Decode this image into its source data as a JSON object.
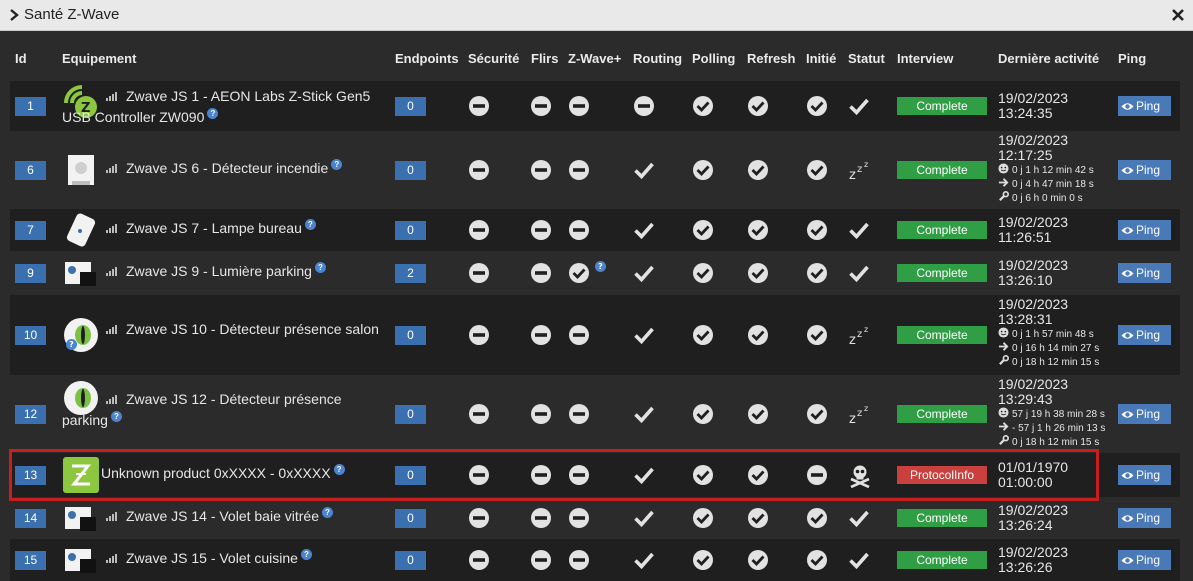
{
  "window": {
    "title": "Santé Z-Wave"
  },
  "columns": [
    "Id",
    "Equipement",
    "Endpoints",
    "Sécurité",
    "Flirs",
    "Z-Wave+",
    "Routing",
    "Polling",
    "Refresh",
    "Initié",
    "Statut",
    "Interview",
    "Dernière activité",
    "Ping"
  ],
  "ping_label": "Ping",
  "rows": [
    {
      "id": "1",
      "name_line1": "Zwave JS 1 - AEON Labs Z-Stick Gen5",
      "name_line2": "USB Controller ZW090",
      "endpoints": "0",
      "icons": [
        "dash",
        "dash",
        "dash",
        "dash",
        "check-circle",
        "check-circle",
        "check-circle",
        "check"
      ],
      "status": "Complete",
      "status_color": "#2f9e44",
      "activity": [
        "19/02/2023",
        "13:24:35"
      ],
      "details": []
    },
    {
      "id": "6",
      "name_line1": "Zwave JS 6 - Détecteur incendie",
      "name_line2": "",
      "endpoints": "0",
      "icons": [
        "dash",
        "dash",
        "dash",
        "check",
        "check-circle",
        "check-circle",
        "check-circle",
        "sleep"
      ],
      "status": "Complete",
      "status_color": "#2f9e44",
      "activity": [
        "19/02/2023",
        "12:17:25"
      ],
      "details": [
        "0 j 1 h 12 min 42 s",
        "0 j 4 h 47 min 18 s",
        "0 j 6 h 0 min 0 s"
      ]
    },
    {
      "id": "7",
      "name_line1": "Zwave JS 7 - Lampe bureau",
      "name_line2": "",
      "endpoints": "0",
      "icons": [
        "dash",
        "dash",
        "dash",
        "check",
        "check-circle",
        "check-circle",
        "check-circle",
        "check"
      ],
      "status": "Complete",
      "status_color": "#2f9e44",
      "activity": [
        "19/02/2023",
        "11:26:51"
      ],
      "details": []
    },
    {
      "id": "9",
      "name_line1": "Zwave JS 9 - Lumière parking",
      "name_line2": "",
      "endpoints": "2",
      "icons": [
        "dash",
        "dash",
        "check-circle-q",
        "check",
        "check-circle",
        "check-circle",
        "check-circle",
        "check"
      ],
      "status": "Complete",
      "status_color": "#2f9e44",
      "activity": [
        "19/02/2023",
        "13:26:10"
      ],
      "details": []
    },
    {
      "id": "10",
      "name_line1": "Zwave JS 10 - Détecteur présence salon",
      "name_line2": "",
      "endpoints": "0",
      "icons": [
        "dash",
        "dash",
        "dash",
        "check",
        "check-circle",
        "check-circle",
        "check-circle",
        "sleep"
      ],
      "status": "Complete",
      "status_color": "#2f9e44",
      "activity": [
        "19/02/2023",
        "13:28:31"
      ],
      "details": [
        "0 j 1 h 57 min 48 s",
        "0 j 16 h 14 min 27 s",
        "0 j 18 h 12 min 15 s"
      ]
    },
    {
      "id": "12",
      "name_line1": "Zwave JS 12 - Détecteur présence",
      "name_line2": "parking",
      "endpoints": "0",
      "icons": [
        "dash",
        "dash",
        "dash",
        "check",
        "check-circle",
        "check-circle",
        "check-circle",
        "sleep"
      ],
      "status": "Complete",
      "status_color": "#2f9e44",
      "activity": [
        "19/02/2023",
        "13:29:43"
      ],
      "details": [
        "57 j 19 h 38 min 28 s",
        "- 57 j 1 h 26 min 13 s",
        "0 j 18 h 12 min 15 s"
      ]
    },
    {
      "id": "13",
      "name_line1": "Unknown product 0xXXXX - 0xXXXX",
      "name_line2": "",
      "endpoints": "0",
      "icons": [
        "dash",
        "dash",
        "dash",
        "check",
        "check-circle",
        "check-circle",
        "dash",
        "skull"
      ],
      "status": "ProtocolInfo",
      "status_color": "#c9403f",
      "activity": [
        "01/01/1970",
        "01:00:00"
      ],
      "details": []
    },
    {
      "id": "14",
      "name_line1": "Zwave JS 14 - Volet baie vitrée",
      "name_line2": "",
      "endpoints": "0",
      "icons": [
        "dash",
        "dash",
        "dash",
        "check",
        "check-circle",
        "check-circle",
        "check-circle",
        "check"
      ],
      "status": "Complete",
      "status_color": "#2f9e44",
      "activity": [
        "19/02/2023",
        "13:26:24"
      ],
      "details": []
    },
    {
      "id": "15",
      "name_line1": "Zwave JS 15 - Volet cuisine",
      "name_line2": "",
      "endpoints": "0",
      "icons": [
        "dash",
        "dash",
        "dash",
        "check",
        "check-circle",
        "check-circle",
        "check-circle",
        "check"
      ],
      "status": "Complete",
      "status_color": "#2f9e44",
      "activity": [
        "19/02/2023",
        "13:26:26"
      ],
      "details": []
    }
  ]
}
